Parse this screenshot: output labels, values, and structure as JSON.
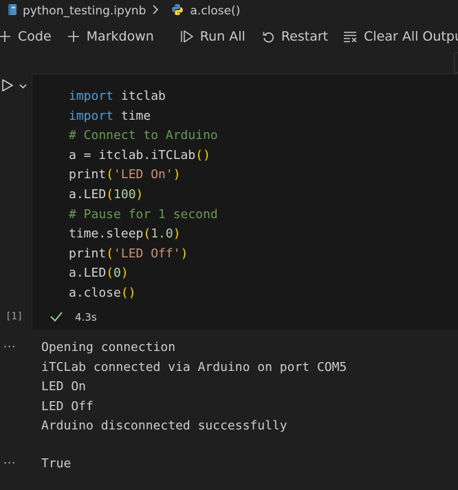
{
  "breadcrumb": {
    "file": "python_testing.ipynb",
    "separator": ">",
    "symbol": "a.close()",
    "file_icon": "notebook-icon",
    "symbol_icon": "python-icon"
  },
  "toolbar": {
    "code_label": "Code",
    "markdown_label": "Markdown",
    "run_all_label": "Run All",
    "restart_label": "Restart",
    "clear_label": "Clear All Outputs"
  },
  "cell": {
    "code_lines": [
      [
        {
          "t": "import",
          "c": "kw"
        },
        {
          "t": " itclab",
          "c": "fn"
        }
      ],
      [
        {
          "t": "import",
          "c": "kw"
        },
        {
          "t": " time",
          "c": "fn"
        }
      ],
      [
        {
          "t": "# Connect to Arduino",
          "c": "cm"
        }
      ],
      [
        {
          "t": "a = itclab.iTCLab",
          "c": "fn"
        },
        {
          "t": "()",
          "c": "br"
        }
      ],
      [
        {
          "t": "print",
          "c": "fn"
        },
        {
          "t": "(",
          "c": "br"
        },
        {
          "t": "'LED On'",
          "c": "st"
        },
        {
          "t": ")",
          "c": "br"
        }
      ],
      [
        {
          "t": "a.LED",
          "c": "fn"
        },
        {
          "t": "(",
          "c": "br"
        },
        {
          "t": "100",
          "c": "nu"
        },
        {
          "t": ")",
          "c": "br"
        }
      ],
      [
        {
          "t": "# Pause for 1 second",
          "c": "cm"
        }
      ],
      [
        {
          "t": "time.sleep",
          "c": "fn"
        },
        {
          "t": "(",
          "c": "br"
        },
        {
          "t": "1.0",
          "c": "nu"
        },
        {
          "t": ")",
          "c": "br"
        }
      ],
      [
        {
          "t": "print",
          "c": "fn"
        },
        {
          "t": "(",
          "c": "br"
        },
        {
          "t": "'LED Off'",
          "c": "st"
        },
        {
          "t": ")",
          "c": "br"
        }
      ],
      [
        {
          "t": "a.LED",
          "c": "fn"
        },
        {
          "t": "(",
          "c": "br"
        },
        {
          "t": "0",
          "c": "nu"
        },
        {
          "t": ")",
          "c": "br"
        }
      ],
      [
        {
          "t": "a.close",
          "c": "fn"
        },
        {
          "t": "()",
          "c": "br"
        }
      ]
    ],
    "execution_count": "[1]",
    "duration": "4.3s",
    "status": "success"
  },
  "outputs": {
    "more_glyph": "···",
    "stdout": "Opening connection\niTCLab connected via Arduino on port COM5\nLED On\nLED Off\nArduino disconnected successfully",
    "result": "True"
  },
  "colors": {
    "background": "#1f1f1f",
    "editor_bg": "#181818",
    "keyword": "#569cd6",
    "comment": "#6a9955",
    "string": "#ce9178",
    "number": "#b5cea8",
    "bracket": "#ffd700",
    "success": "#89d185",
    "python_blue": "#4b8bbe"
  }
}
